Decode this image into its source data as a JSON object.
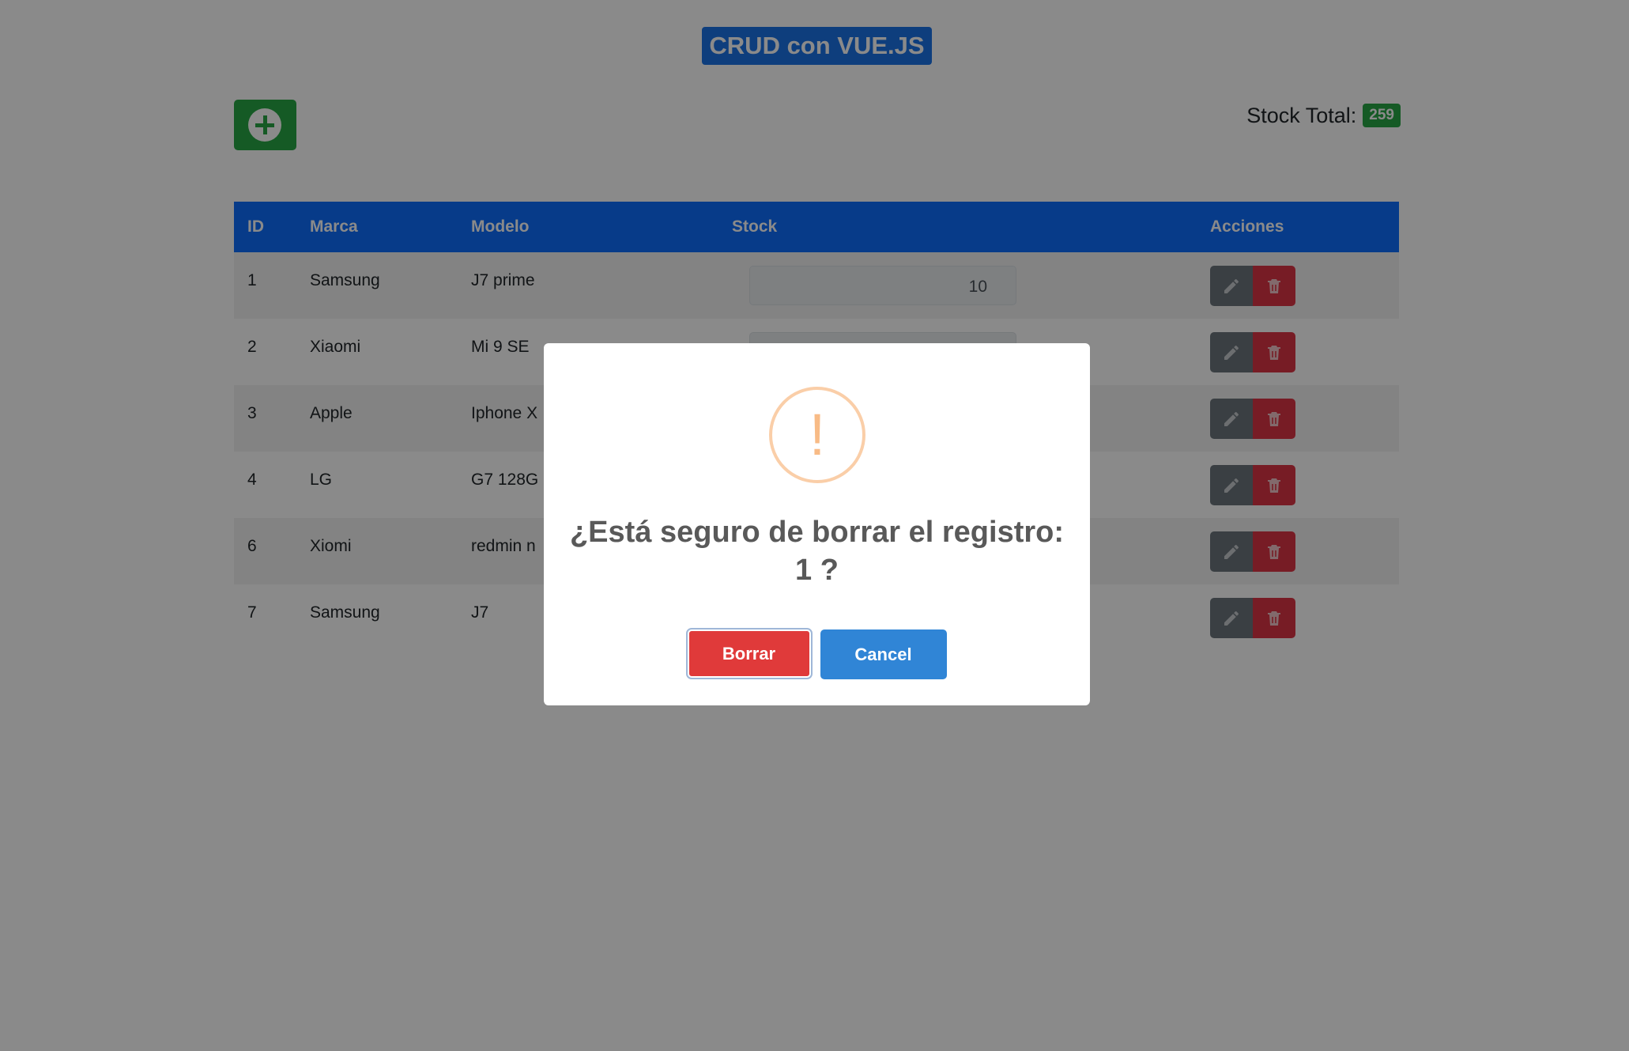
{
  "header": {
    "title": "CRUD con VUE.JS"
  },
  "toolbar": {
    "add_icon": "plus-circle-icon",
    "stock_total_label": "Stock Total:",
    "stock_total_value": "259"
  },
  "table": {
    "columns": [
      "ID",
      "Marca",
      "Modelo",
      "Stock",
      "Acciones"
    ],
    "rows": [
      {
        "id": "1",
        "marca": "Samsung",
        "modelo": "J7 prime",
        "stock": "10"
      },
      {
        "id": "2",
        "marca": "Xiaomi",
        "modelo": "Mi 9 SE",
        "stock": ""
      },
      {
        "id": "3",
        "marca": "Apple",
        "modelo": "Iphone X",
        "stock": ""
      },
      {
        "id": "4",
        "marca": "LG",
        "modelo": "G7 128G",
        "stock": ""
      },
      {
        "id": "6",
        "marca": "Xiomi",
        "modelo": "redmin n",
        "stock": ""
      },
      {
        "id": "7",
        "marca": "Samsung",
        "modelo": "J7",
        "stock": ""
      }
    ],
    "action_icons": [
      "pencil-icon",
      "trash-icon"
    ]
  },
  "modal": {
    "icon": "warning-icon",
    "icon_glyph": "!",
    "message": "¿Está seguro de borrar el registro: 1 ?",
    "confirm_label": "Borrar",
    "cancel_label": "Cancel"
  },
  "colors": {
    "primary": "#0d6efd",
    "success": "#28a745",
    "danger": "#dc3545",
    "secondary": "#6c757d",
    "cancel": "#3085d6"
  }
}
